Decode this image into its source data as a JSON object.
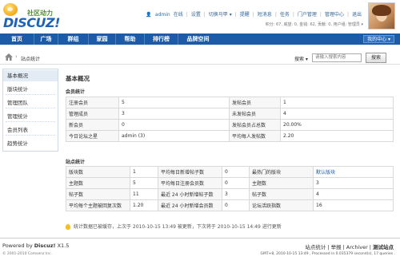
{
  "logo": {
    "tagline": "社区动力",
    "wordmark": "DISCUZ!"
  },
  "userbar": {
    "username": "admin",
    "status": "在线",
    "items": [
      "设置",
      "切换马甲 ▾",
      "提醒",
      "短消息",
      "任务",
      "门户管理",
      "管理中心",
      "退出"
    ]
  },
  "credits": "积分: 67, 威望: 0, 金钱: 62, 贡献: 0, 用户组: 管理员 ▾",
  "nav": {
    "items": [
      "首页",
      "广场",
      "群组",
      "家园",
      "帮助",
      "排行榜",
      "品牌空间"
    ],
    "my_center": "我的中心 ▾"
  },
  "toolbar": {
    "breadcrumb": "站点统计",
    "search_label": "搜索 ▾",
    "search_placeholder": "请输入搜索内容",
    "search_button": "搜索"
  },
  "sidebar": {
    "items": [
      "基本概况",
      "版块统计",
      "管理团队",
      "管理统计",
      "会员列表",
      "趋势统计"
    ]
  },
  "main": {
    "title": "基本概况",
    "members_section": "会员统计",
    "members_rows": [
      [
        "注册会员",
        "5",
        "发帖会员",
        "1"
      ],
      [
        "管理成员",
        "3",
        "未发帖会员",
        "4"
      ],
      [
        "新会员",
        "0",
        "发帖会员占总数",
        "20.00%"
      ],
      [
        "今日论坛之星",
        "admin (3)",
        "平均每人发帖数",
        "2.20"
      ]
    ],
    "forum_section": "站点统计",
    "forum_rows": [
      [
        "版块数",
        "1",
        "平均每日新增帖子数",
        "0",
        "最热门的版块",
        "默认版块"
      ],
      [
        "主题数",
        "5",
        "平均每日注册会员数",
        "0",
        "主题数",
        "3"
      ],
      [
        "帖子数",
        "11",
        "最近 24 小时新增帖子数",
        "3",
        "帖子数",
        "4"
      ],
      [
        "平均每个主题被回复次数",
        "1.20",
        "最近 24 小时新增会员数",
        "0",
        "论坛活跃指数",
        "16"
      ]
    ],
    "update_note": "统计数据已被缓存，上次于 2010-10-15 13:49 被更新，下次将于 2010-10-15 14:49 进行更新"
  },
  "footer": {
    "powered_prefix": "Powered by",
    "powered_brand": "Discuz!",
    "version": "X1.5",
    "copyright": "© 2001-2010 Comsenz Inc.",
    "links": [
      "站点统计",
      "举报",
      "Archiver",
      "测试站点"
    ],
    "gmt": "GMT+8, 2010-10-15 13:49 , Processed in 0.035379 second(s), 17 queries ."
  },
  "colors": {
    "nav": "#1d5aa7",
    "link": "#1d5aa7",
    "sidebar_active": "#e3ebf5"
  }
}
